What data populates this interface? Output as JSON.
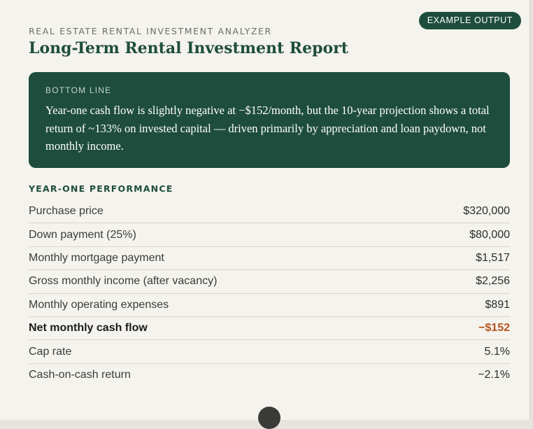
{
  "badge": "EXAMPLE OUTPUT",
  "header": {
    "eyebrow": "REAL ESTATE RENTAL INVESTMENT ANALYZER",
    "title": "Long-Term Rental Investment Report"
  },
  "bottom_line": {
    "label": "BOTTOM LINE",
    "text": "Year-one cash flow is slightly negative at −$152/month, but the 10-year projection shows a total return of ~133% on invested capital — driven primarily by appreciation and loan paydown, not monthly income."
  },
  "performance": {
    "heading": "YEAR-ONE PERFORMANCE",
    "rows": [
      {
        "label": "Purchase price",
        "value": "$320,000"
      },
      {
        "label": "Down payment (25%)",
        "value": "$80,000"
      },
      {
        "label": "Monthly mortgage payment",
        "value": "$1,517"
      },
      {
        "label": "Gross monthly income (after vacancy)",
        "value": "$2,256"
      },
      {
        "label": "Monthly operating expenses",
        "value": "$891"
      },
      {
        "label": "Net monthly cash flow",
        "value": "−$152"
      },
      {
        "label": "Cap rate",
        "value": "5.1%"
      },
      {
        "label": "Cash-on-cash return",
        "value": "−2.1%"
      }
    ]
  },
  "colors": {
    "brand_green": "#1e4d3e",
    "negative_accent": "#b4541f",
    "background": "#f5f3ed"
  }
}
